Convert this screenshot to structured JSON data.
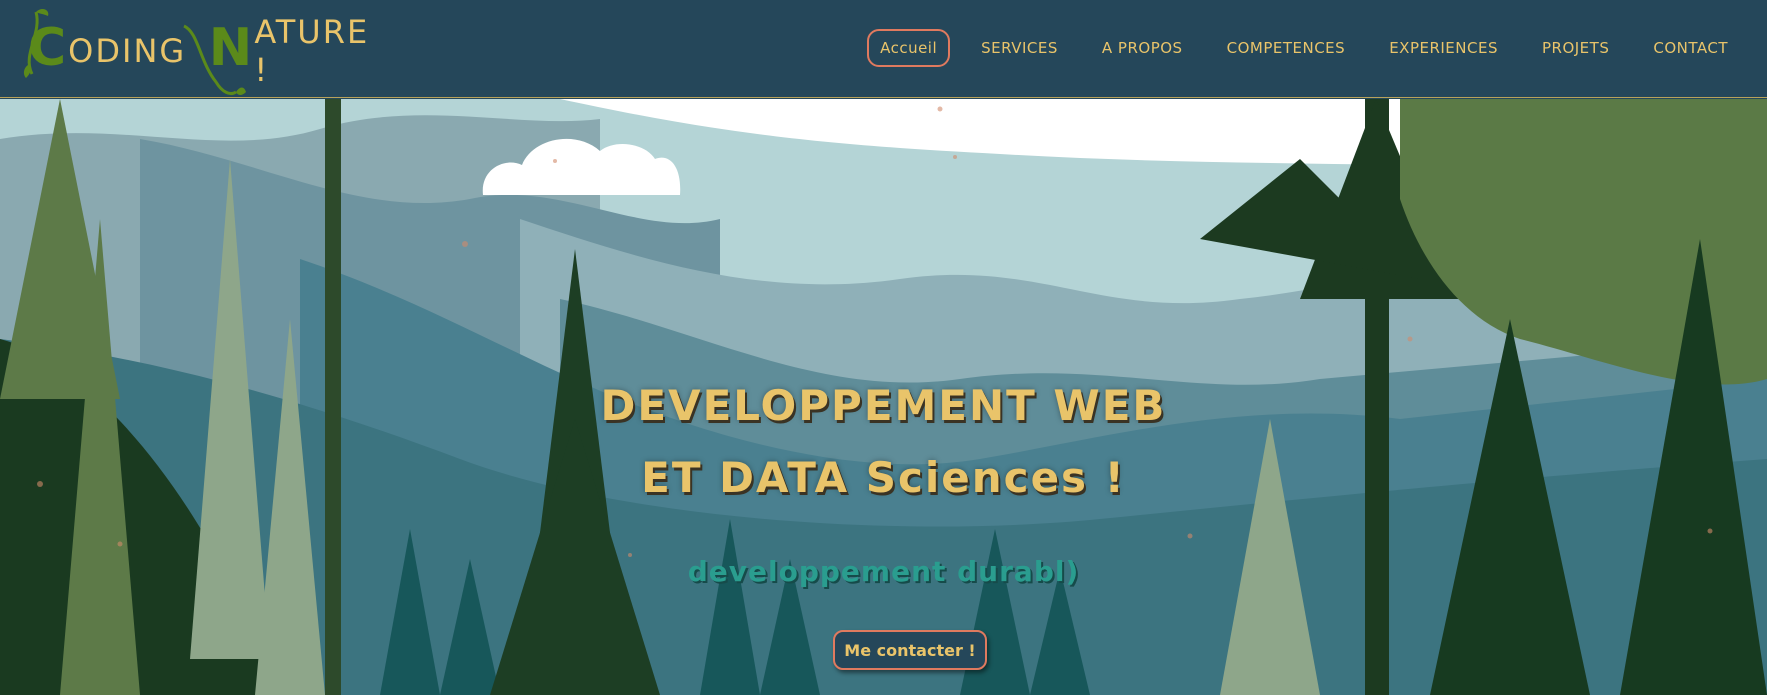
{
  "brand": {
    "initial_1": "C",
    "rest_1": "ODING",
    "initial_2": "N",
    "rest_2": "ATURE !"
  },
  "nav": {
    "items": [
      {
        "label": "Accueil",
        "active": true
      },
      {
        "label": "SERVICES",
        "active": false
      },
      {
        "label": "A PROPOS",
        "active": false
      },
      {
        "label": "COMPETENCES",
        "active": false
      },
      {
        "label": "EXPERIENCES",
        "active": false
      },
      {
        "label": "PROJETS",
        "active": false
      },
      {
        "label": "CONTACT",
        "active": false
      }
    ]
  },
  "hero": {
    "title_line_1": "DEVELOPPEMENT WEB",
    "title_line_2": "ET DATA Sciences !",
    "subtitle": "developpement durabl)",
    "cta_label": "Me contacter !"
  },
  "colors": {
    "nav_bg": "#25475a",
    "accent_gold": "#e9c46a",
    "accent_coral": "#e07a5f",
    "teal": "#2a9d8f",
    "logo_green": "#5b8a1a"
  }
}
